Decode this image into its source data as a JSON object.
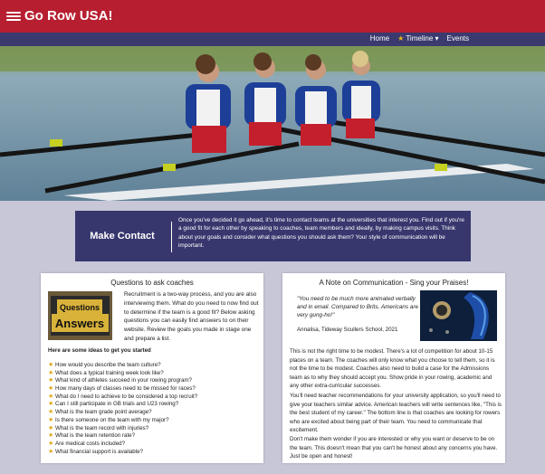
{
  "header": {
    "title": "Go Row USA!",
    "menu_icon": "hamburger-icon",
    "brand_color": "#b71f31"
  },
  "nav": {
    "home": "Home",
    "timeline": "Timeline",
    "events": "Events",
    "nav_color": "#3b3a6e"
  },
  "contact": {
    "title": "Make Contact",
    "body": "Once you've decided it go ahead, it's time to contact teams at the universities that interest you. Find out if you're a good fit for each other by speaking to coaches, team members and ideally, by making campus visits. Think about your goals and consider what questions you should ask them? Your style of communication will be important."
  },
  "questions_card": {
    "title": "Questions to ask coaches",
    "image_label_top": "Questions",
    "image_label_bottom": "Answers",
    "intro": "Recruitment is a two-way process, and you are also interviewing them. What do you need to now find out to determine if the team is a good fit? Below asking questions you can easily find answers to on their website. Review the goals you made in stage one and prepare a list.",
    "lead": "Here are some ideas to get you started",
    "questions": [
      "How would you describe the team culture?",
      "What does a typical training week look like?",
      "What kind of athletes succeed in your rowing program?",
      "How many days of classes need to be missed for races?",
      "What do I need to achieve to be considered a top recruit?",
      "Can I still participate in GB trials and U23 rowing?",
      "What is the team grade point average?",
      "Is there someone on the team with my major?",
      "What is the team record with injuries?",
      "What is the team retention rate?",
      "Are medical costs included?",
      "What financial support is available?"
    ]
  },
  "note_card": {
    "title": "A Note on Communication - Sing your Praises!",
    "quote": "\"You need to be much more animated verbally and in email. Compared to Brits, Americans are very gung-ho!\"",
    "attribution": "Annalisa, Tideway Scullers School, 2021",
    "paragraphs": [
      "This is not the right time to be modest. There's a lot of competition for about 10-15 places on a team. The coaches will only know what you choose to tell them, so it is not the time to be modest. Coaches also need to build a case for the Admissions team as to why they should accept you. Show pride in your rowing, academic and any other extra-curricular successes.",
      "You'll need teacher recommendations for your university application, so you'll need to give your teachers similar advice. American teachers will write sentences like, \"This is the best student of my career.\" The bottom line is that coaches are looking for rowers who are excited about being part of their team. You need to communicate that excitement.",
      "Don't make them wonder if you are interested or why you want or deserve to be on the team. This doesn't mean that you can't be honest about any concerns you have. Just be open and honest!"
    ]
  }
}
